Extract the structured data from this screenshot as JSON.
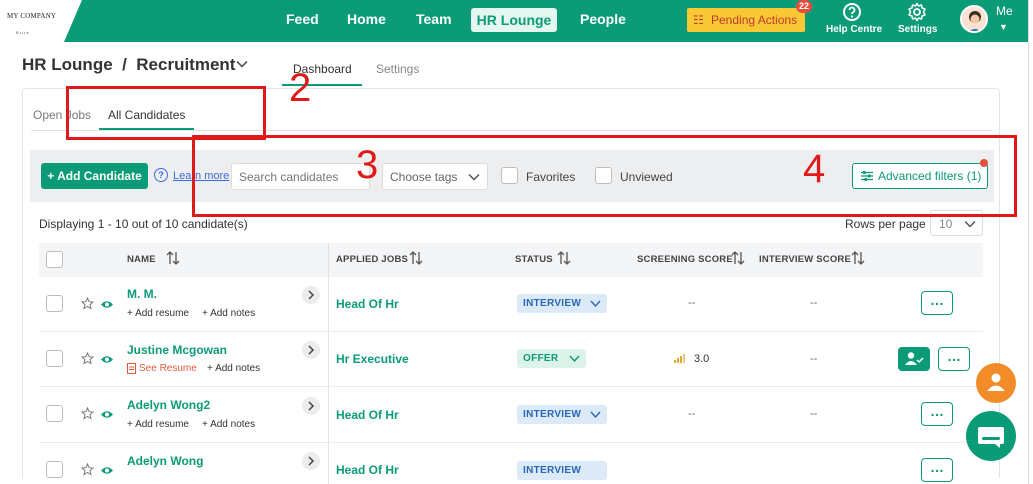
{
  "brand": {
    "logo_text": "MY COMPANY",
    "logo_sub": "B r i t e"
  },
  "nav": {
    "feed": "Feed",
    "home": "Home",
    "team": "Team",
    "hr_lounge": "HR Lounge",
    "people": "People"
  },
  "pending": {
    "label": "Pending Actions",
    "count": "22"
  },
  "top_right": {
    "help": "Help Centre",
    "settings": "Settings",
    "me": "Me"
  },
  "header": {
    "title": "HR Lounge  /  Recruitment",
    "tab_dashboard": "Dashboard",
    "tab_settings": "Settings"
  },
  "subtabs": {
    "open_jobs": "Open Jobs",
    "all_candidates": "All Candidates"
  },
  "toolbar": {
    "add_label": "+ Add Candidate",
    "learn_more": "Learn more",
    "search_placeholder": "Search candidates",
    "tags_placeholder": "Choose tags",
    "favorites": "Favorites",
    "unviewed": "Unviewed",
    "advanced_filters": "Advanced filters (1)"
  },
  "annotations": {
    "a2": "2",
    "a3": "3",
    "a4": "4"
  },
  "listing": {
    "display_text": "Displaying 1 - 10 out of 10 candidate(s)",
    "rows_per_page_label": "Rows per page",
    "rows_per_page_value": "10"
  },
  "table": {
    "headers": {
      "name": "NAME",
      "applied_jobs": "APPLIED JOBS",
      "status": "STATUS",
      "screening": "SCREENING SCORE",
      "interview": "INTERVIEW SCORE"
    },
    "add_resume": "+ Add resume",
    "add_notes": "+ Add notes",
    "see_resume": "See Resume",
    "dash": "--",
    "rows": [
      {
        "name": "M. M.",
        "job": "Head Of Hr",
        "status": "INTERVIEW",
        "screening": "--",
        "interview": "--"
      },
      {
        "name": "Justine Mcgowan",
        "job": "Hr Executive",
        "status": "OFFER",
        "screening": "3.0",
        "interview": "--"
      },
      {
        "name": "Adelyn Wong2",
        "job": "Head Of Hr",
        "status": "INTERVIEW",
        "screening": "--",
        "interview": "--"
      },
      {
        "name": "Adelyn Wong",
        "job": "Head Of Hr",
        "status": "INTERVIEW",
        "screening": "",
        "interview": ""
      }
    ]
  },
  "colors": {
    "brand": "#0b9b77",
    "annotation": "#e01a1a",
    "pending": "#f9c935"
  }
}
